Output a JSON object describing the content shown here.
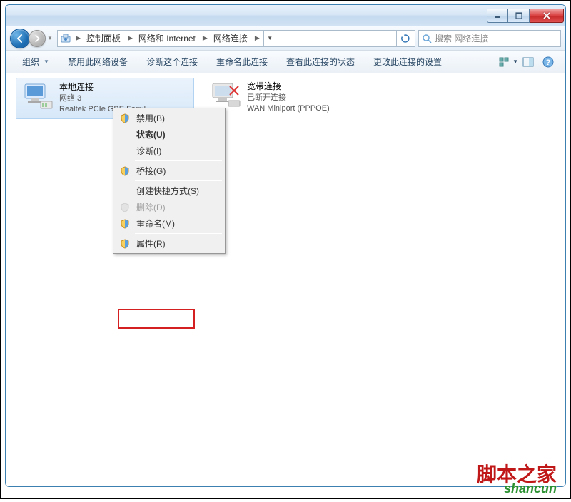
{
  "titlebar": {},
  "navbar": {
    "breadcrumb": [
      "控制面板",
      "网络和 Internet",
      "网络连接"
    ],
    "search_placeholder": "搜索 网络连接"
  },
  "toolbar": {
    "organize": "组织",
    "disable_device": "禁用此网络设备",
    "diagnose": "诊断这个连接",
    "rename": "重命名此连接",
    "view_status": "查看此连接的状态",
    "change_settings": "更改此连接的设置"
  },
  "connections": [
    {
      "name": "本地连接",
      "line2": "网络  3",
      "line3": "Realtek PCIe GBE Famil..."
    },
    {
      "name": "宽带连接",
      "line2": "已断开连接",
      "line3": "WAN Miniport (PPPOE)"
    }
  ],
  "context_menu": {
    "disable": "禁用(B)",
    "status": "状态(U)",
    "diagnose": "诊断(I)",
    "bridge": "桥接(G)",
    "shortcut": "创建快捷方式(S)",
    "delete": "删除(D)",
    "rename": "重命名(M)",
    "properties": "属性(R)"
  },
  "watermark": {
    "line1": "脚本之家",
    "line2": "shancun"
  }
}
